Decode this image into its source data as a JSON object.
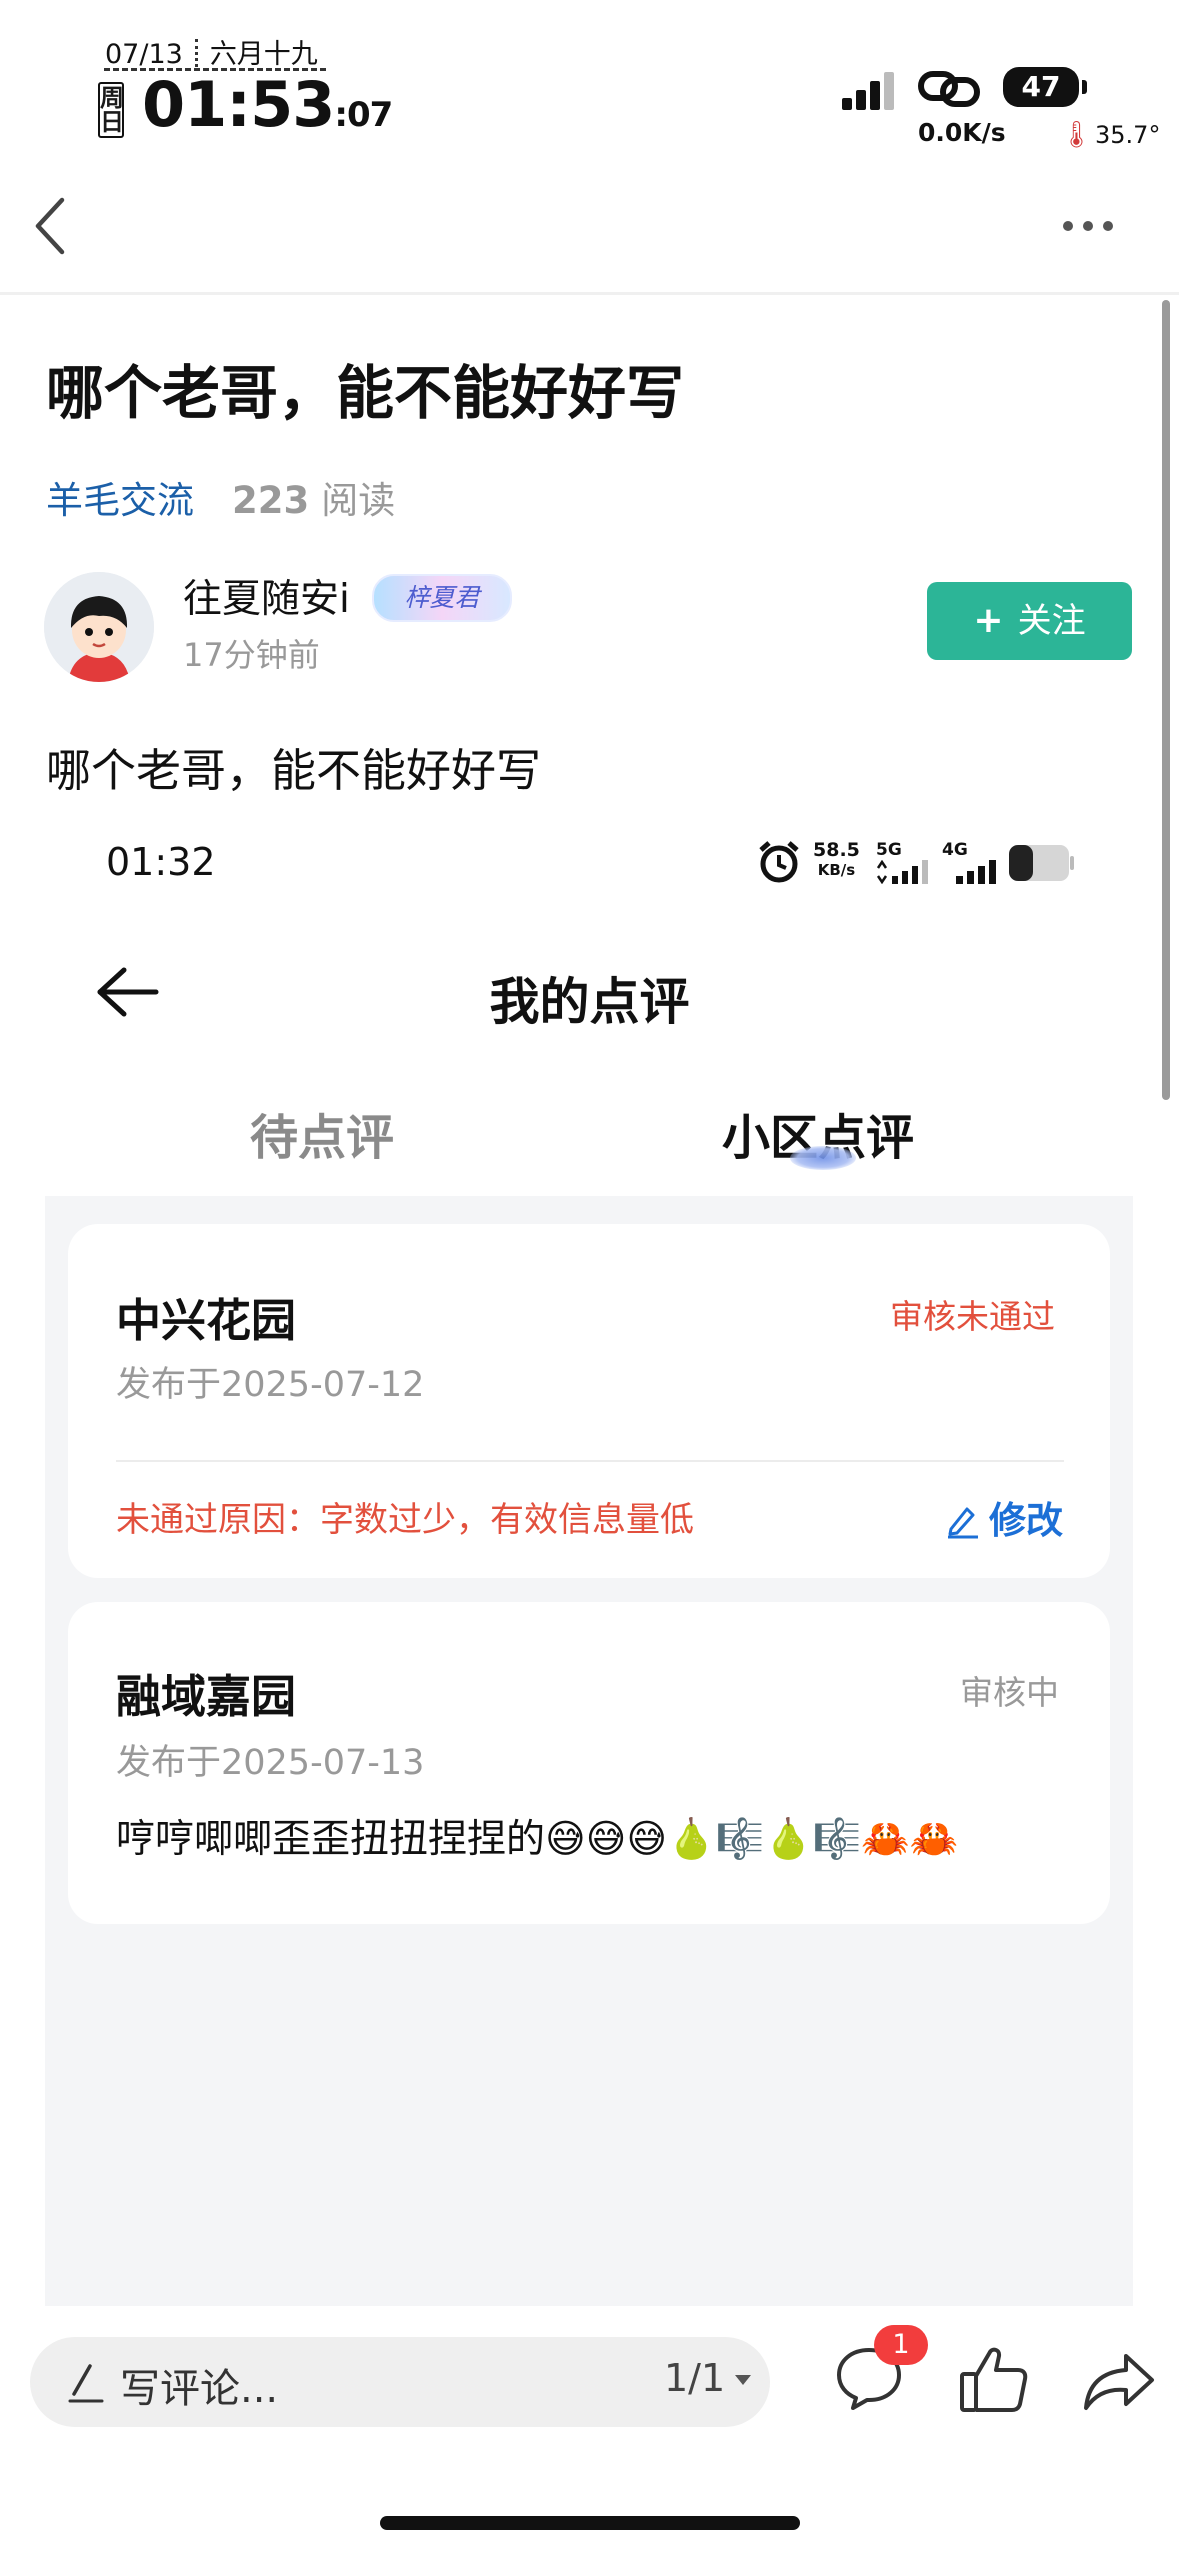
{
  "status_bar": {
    "date": "07/13",
    "lunar_date": "六月十九",
    "weekday": "周日",
    "time": "01:53",
    "seconds": ":07",
    "battery": "47",
    "net_speed": "0.0K/s",
    "temperature": "35.7°"
  },
  "post": {
    "title": "哪个老哥，能不能好好写",
    "channel": "羊毛交流",
    "read_count": "223",
    "read_label": "阅读",
    "author": "往夏随安i",
    "author_badge": "梓夏君",
    "post_time": "17分钟前",
    "follow_label": "关注",
    "body": "哪个老哥，能不能好好写"
  },
  "embedded": {
    "time": "01:32",
    "speed_value": "58.5",
    "speed_unit": "KB/s",
    "net_5g": "5G",
    "net_4g": "4G",
    "page_title": "我的点评",
    "tabs": [
      "待点评",
      "小区点评"
    ],
    "reviews": [
      {
        "name": "中兴花园",
        "date": "发布于2025-07-12",
        "status": "审核未通过",
        "reason": "未通过原因：字数过少，有效信息量低",
        "edit_label": "修改"
      },
      {
        "name": "融域嘉园",
        "date": "发布于2025-07-13",
        "status": "审核中",
        "content": "哼哼唧唧歪歪扭扭捏捏的😅😅😅🍐🎼🍐🎼🦀🦀"
      }
    ]
  },
  "bottom_bar": {
    "comment_placeholder": "写评论...",
    "page_indicator": "1/1",
    "comment_count": "1"
  },
  "colors": {
    "follow_button": "#2cb597",
    "channel_link": "#1b5fa8",
    "rejected_status": "#e2503d",
    "edit_link": "#1c6fd6",
    "notification_badge": "#f23d3d"
  }
}
